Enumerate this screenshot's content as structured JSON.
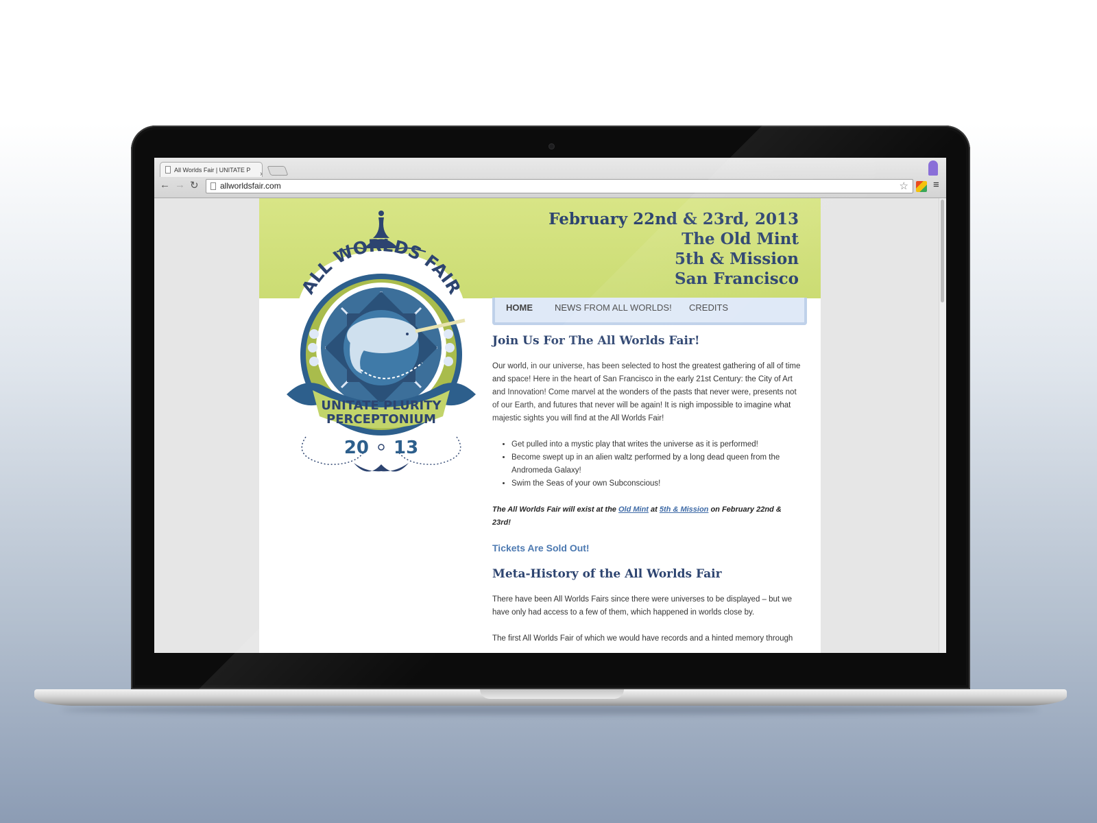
{
  "browser": {
    "tab_title": "All Worlds Fair | UNITATE P",
    "tab_close": "×",
    "url": "allworldsfair.com",
    "back_glyph": "←",
    "forward_glyph": "→",
    "reload_glyph": "↻",
    "star_glyph": "☆",
    "menu_glyph": "≡"
  },
  "header": {
    "date_line": "February 22nd & 23rd, 2013",
    "venue_line": "The Old Mint",
    "address_line": "5th & Mission",
    "city_line": "San Francisco"
  },
  "logo": {
    "title_arc": "ALL WORLDS FAIR",
    "line1": "UNITATE PLURITY",
    "line2": "PERCEPTONIUM",
    "year_left": "20",
    "year_right": "13"
  },
  "nav": {
    "items": [
      {
        "label": "HOME",
        "active": true
      },
      {
        "label": "NEWS FROM ALL WORLDS!",
        "active": false
      },
      {
        "label": "CREDITS",
        "active": false
      }
    ]
  },
  "content": {
    "heading1": "Join Us For The All Worlds Fair!",
    "intro": "Our world, in our universe, has been selected to host the greatest gathering of all of time and space! Here in the heart of San Francisco in the early 21st Century: the City of Art and Innovation! Come marvel at the wonders of the pasts that never were, presents not of our Earth, and futures that never will be again! It is nigh impossible to imagine what majestic sights you will find at the All Worlds Fair!",
    "bullets": [
      "Get pulled into a mystic play that writes the universe as it is performed!",
      "Become swept up in an alien waltz performed by a long dead queen from the Andromeda Galaxy!",
      "Swim the Seas of your own Subconscious!"
    ],
    "fair_text_1": "The All Worlds Fair will exist at the ",
    "fair_link_1": "Old Mint",
    "fair_text_2": " at ",
    "fair_link_2": "5th & Mission",
    "fair_text_3": " on February 22nd & 23rd!",
    "tickets": "Tickets Are Sold Out!",
    "heading2": "Meta-History of the All Worlds Fair",
    "meta": "There have been All Worlds Fairs since there were universes to be displayed – but we have only had access to a few of them, which happened in worlds close by.",
    "cut_line": "The first All Worlds Fair of which we would have records and a hinted memory through"
  },
  "colors": {
    "header_green": "#d3e27e",
    "navy": "#2d4470",
    "link_blue": "#3e6aa6",
    "nav_bg": "#dfe9f7"
  }
}
